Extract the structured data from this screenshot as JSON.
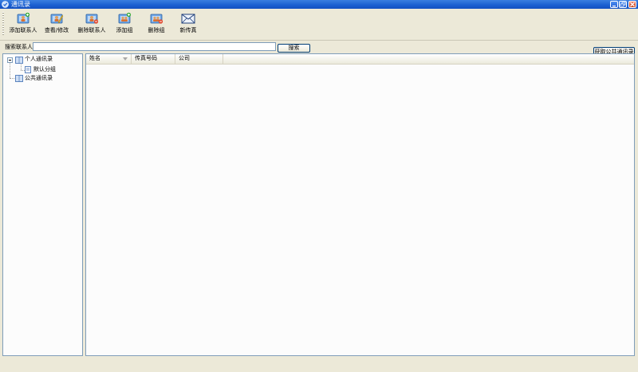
{
  "window": {
    "title": "通讯录",
    "controls": [
      "minimize-icon",
      "restore-icon",
      "close-icon"
    ],
    "title_bar_color": "#1a5fd0"
  },
  "toolbar": {
    "buttons": [
      {
        "label": "添加联系人",
        "icon": "add-contact-icon"
      },
      {
        "label": "查看/修改",
        "icon": "edit-contact-icon"
      },
      {
        "label": "删除联系人",
        "icon": "delete-contact-icon"
      },
      {
        "label": "添加组",
        "icon": "add-group-icon"
      },
      {
        "label": "删除组",
        "icon": "delete-group-icon"
      },
      {
        "label": "新传真",
        "icon": "new-fax-icon"
      }
    ]
  },
  "search": {
    "label": "搜索联系人",
    "value": "",
    "button_label": "搜索"
  },
  "get_public_button_label": "获取公共通讯录",
  "tree": {
    "nodes": [
      {
        "label": "个人通讯录",
        "icon": "address-book-icon",
        "expanded": true,
        "children": [
          {
            "label": "默认分组",
            "icon": "group-icon"
          }
        ]
      },
      {
        "label": "公共通讯录",
        "icon": "address-book-icon"
      }
    ]
  },
  "list": {
    "columns": [
      {
        "label": "姓名",
        "sorted": true
      },
      {
        "label": "传真号码"
      },
      {
        "label": "公司"
      }
    ],
    "rows": []
  }
}
